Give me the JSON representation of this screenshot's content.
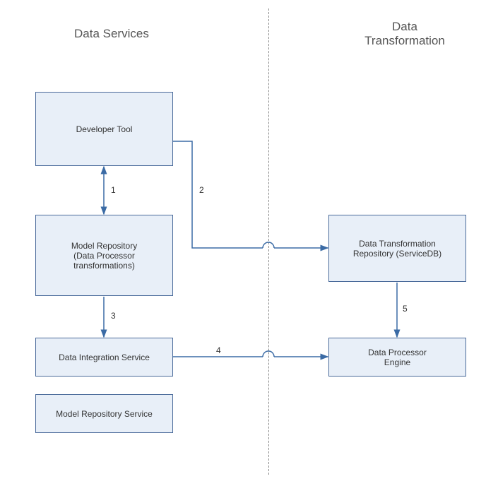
{
  "headers": {
    "left": "Data Services",
    "right": "Data\nTransformation"
  },
  "boxes": {
    "dev_tool": "Developer Tool",
    "model_repo": "Model Repository\n(Data Processor\ntransformations)",
    "data_integration": "Data Integration Service",
    "model_repo_service": "Model Repository Service",
    "dt_repo": "Data Transformation\nRepository (ServiceDB)",
    "dp_engine": "Data Processor\nEngine"
  },
  "labels": {
    "e1": "1",
    "e2": "2",
    "e3": "3",
    "e4": "4",
    "e5": "5"
  },
  "chart_data": {
    "type": "diagram",
    "groups": [
      {
        "name": "Data Services",
        "nodes": [
          "Developer Tool",
          "Model Repository (Data Processor transformations)",
          "Data Integration Service",
          "Model Repository Service"
        ]
      },
      {
        "name": "Data Transformation",
        "nodes": [
          "Data Transformation Repository (ServiceDB)",
          "Data Processor Engine"
        ]
      }
    ],
    "edges": [
      {
        "id": 1,
        "from": "Developer Tool",
        "to": "Model Repository (Data Processor transformations)",
        "bidirectional": true
      },
      {
        "id": 2,
        "from": "Developer Tool",
        "to": "Data Transformation Repository (ServiceDB)",
        "bidirectional": false
      },
      {
        "id": 3,
        "from": "Model Repository (Data Processor transformations)",
        "to": "Data Integration Service",
        "bidirectional": false
      },
      {
        "id": 4,
        "from": "Data Integration Service",
        "to": "Data Processor Engine",
        "bidirectional": false
      },
      {
        "id": 5,
        "from": "Data Transformation Repository (ServiceDB)",
        "to": "Data Processor Engine",
        "bidirectional": false
      }
    ]
  }
}
